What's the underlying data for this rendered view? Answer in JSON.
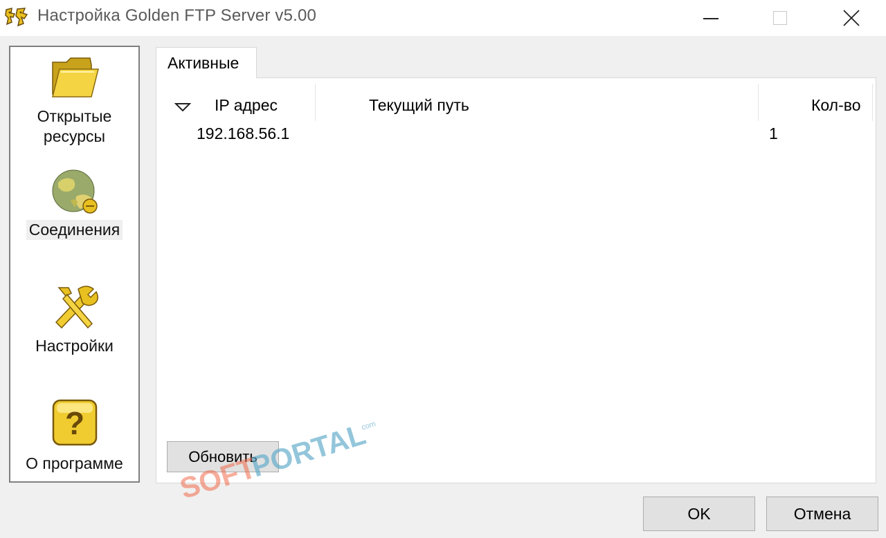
{
  "window": {
    "title": "Настройка Golden FTP Server v5.00",
    "icon": "golden-ftp-app-icon"
  },
  "nav": {
    "items": [
      {
        "label": "Открытые ресурсы",
        "icon": "folder-icon"
      },
      {
        "label": "Соединения",
        "icon": "connections-globe-icon",
        "selected": true
      },
      {
        "label": "Настройки",
        "icon": "tools-icon"
      },
      {
        "label": "О программе",
        "icon": "help-icon"
      }
    ]
  },
  "tabs": [
    {
      "label": "Активные",
      "active": true
    }
  ],
  "list": {
    "columns": [
      "IP адрес",
      "Текущий путь",
      "Кол-во"
    ],
    "sort": "descending",
    "rows": [
      {
        "ip": "192.168.56.1",
        "path": "",
        "count": "1"
      }
    ]
  },
  "buttons": {
    "refresh": "Обновить",
    "ok": "OK",
    "cancel": "Отмена"
  },
  "watermark": {
    "soft": "SOFT",
    "portal": "PORTAL",
    "com": "com"
  },
  "colors": {
    "accent_gold": "#e8c020",
    "watermark_red": "#f06a4a",
    "watermark_blue": "#5aa8c8"
  }
}
